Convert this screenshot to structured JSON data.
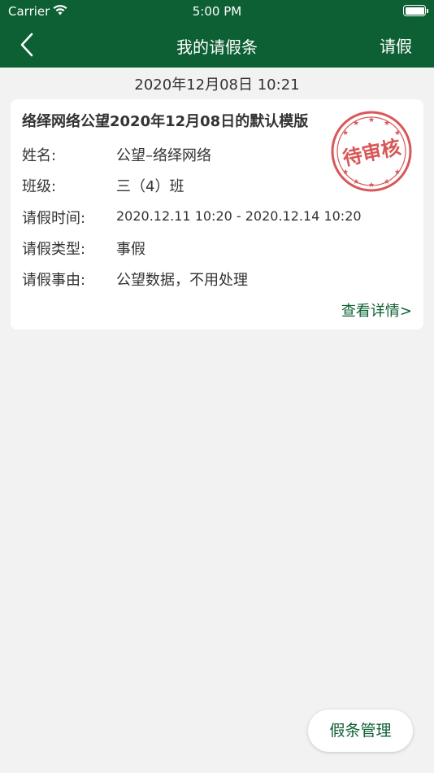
{
  "status_bar": {
    "carrier": "Carrier",
    "time": "5:00 PM"
  },
  "nav": {
    "title": "我的请假条",
    "action": "请假"
  },
  "timestamp": "2020年12月08日 10:21",
  "card": {
    "title": "络绎网络公望2020年12月08日的默认模版",
    "stamp_text": "待审核",
    "rows": [
      {
        "label": "姓名:",
        "value": "公望–络绎网络"
      },
      {
        "label": "班级:",
        "value": "三（4）班"
      },
      {
        "label": "请假时间:",
        "value": "2020.12.11 10:20 - 2020.12.14 10:20"
      },
      {
        "label": "请假类型:",
        "value": "事假"
      },
      {
        "label": "请假事由:",
        "value": "公望数据，不用处理"
      }
    ],
    "detail_link": "查看详情>"
  },
  "fab": {
    "label": "假条管理"
  },
  "colors": {
    "primary": "#0d6033",
    "stamp": "#d23a3a",
    "background": "#f2f2f2"
  }
}
